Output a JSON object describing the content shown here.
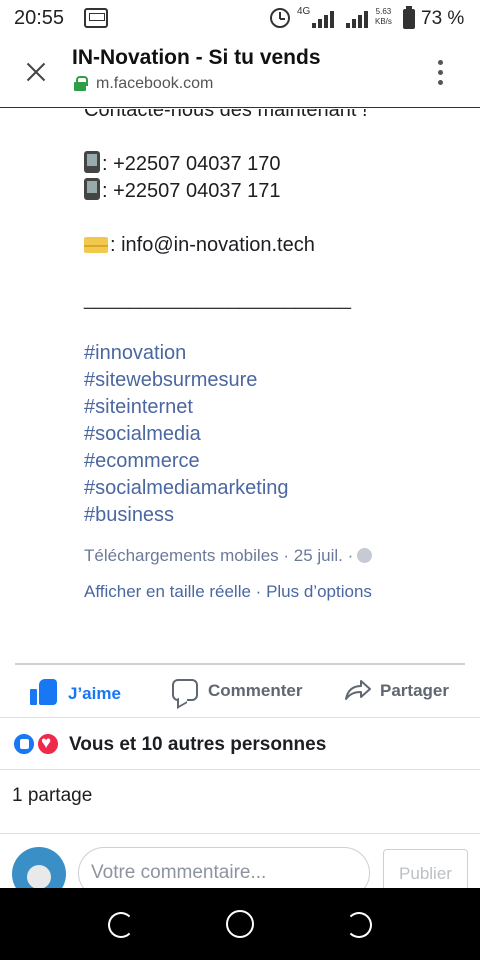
{
  "status_bar": {
    "time": "20:55",
    "network": "4G",
    "speed_value": "5.63",
    "speed_unit": "KB/s",
    "battery": "73 %"
  },
  "browser": {
    "title": "IN-Novation - Si tu vends",
    "url": "m.facebook.com"
  },
  "post": {
    "contact_line": "Contacte-nous dès maintenant !",
    "phones": [
      ": +22507 04037 170",
      ": +22507 04037 171"
    ],
    "email": ": info@in-novation.tech",
    "divider": "________________________",
    "hashtags": [
      "#innovation",
      "#sitewebsurmesure",
      "#siteinternet",
      "#socialmedia",
      "#ecommerce",
      "#socialmediamarketing",
      "#business"
    ],
    "meta": "Téléchargements mobiles · 25 juil. ·",
    "link_full_size": "Afficher en taille réelle",
    "link_separator": " · ",
    "link_more": "Plus d’options"
  },
  "actions": {
    "like": "J’aime",
    "comment": "Commenter",
    "share": "Partager"
  },
  "reactions": {
    "text": "Vous et 10 autres personnes"
  },
  "shares": {
    "text": "1 partage"
  },
  "comment_box": {
    "placeholder": "Votre commentaire...",
    "publish": "Publier"
  },
  "colors": {
    "facebook_blue": "#1877f2",
    "hashtag": "#4b67a1",
    "love_red": "#f0284a",
    "lock_green": "#2e9e47"
  },
  "icons": [
    "blast-icon",
    "alarm-icon",
    "signal-icon",
    "battery-icon",
    "close-icon",
    "lock-icon",
    "menu-icon",
    "phone-icon",
    "mail-icon",
    "globe-icon",
    "like-icon",
    "comment-icon",
    "share-icon",
    "love-reaction-icon",
    "back-icon",
    "home-icon",
    "recent-apps-icon"
  ]
}
